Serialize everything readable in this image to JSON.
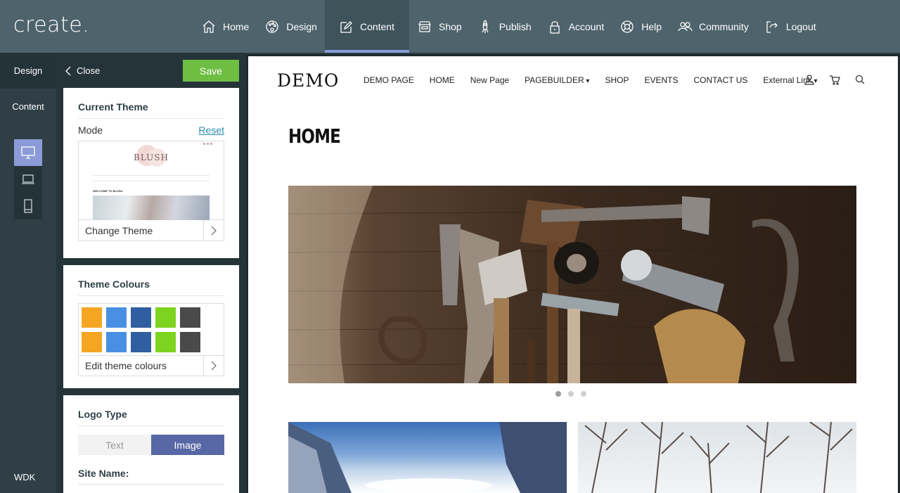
{
  "app": {
    "logo": "create.",
    "nav": [
      {
        "label": "Home",
        "icon": "home-icon"
      },
      {
        "label": "Design",
        "icon": "palette-icon"
      },
      {
        "label": "Content",
        "icon": "edit-icon",
        "active": true
      },
      {
        "label": "Shop",
        "icon": "shop-icon"
      },
      {
        "label": "Publish",
        "icon": "rocket-icon"
      },
      {
        "label": "Account",
        "icon": "lock-icon"
      },
      {
        "label": "Help",
        "icon": "lifebuoy-icon"
      },
      {
        "label": "Community",
        "icon": "community-icon"
      },
      {
        "label": "Logout",
        "icon": "logout-icon"
      }
    ]
  },
  "rail": {
    "design": "Design",
    "content": "Content",
    "wdk": "WDK",
    "devices": [
      "desktop-icon",
      "laptop-icon",
      "mobile-icon"
    ]
  },
  "panel": {
    "close": "Close",
    "save": "Save",
    "current_theme": {
      "title": "Current Theme",
      "mode": "Mode",
      "reset": "Reset",
      "theme_preview_name": "BLUSH",
      "theme_preview_welcome": "WELCOME TO BLUSH",
      "change_theme": "Change Theme"
    },
    "theme_colours": {
      "title": "Theme Colours",
      "swatches": [
        "#f4a623",
        "#4a90e2",
        "#2f5fa0",
        "#7ed321",
        "#4a4a4a",
        "#f4a623",
        "#4a90e2",
        "#2f5fa0",
        "#7ed321",
        "#4a4a4a"
      ],
      "edit": "Edit theme colours"
    },
    "logo_type": {
      "title": "Logo Type",
      "text_option": "Text",
      "image_option": "Image",
      "selected": "Image",
      "site_name": "Site Name:"
    }
  },
  "preview": {
    "site_logo": "DEMO",
    "nav": [
      "DEMO PAGE",
      "HOME",
      "New Page",
      "PAGEBUILDER",
      "SHOP",
      "EVENTS",
      "CONTACT US",
      "External Link"
    ],
    "icons": [
      "user-icon",
      "cart-icon",
      "search-icon"
    ],
    "page_title": "HOME",
    "slider": {
      "total": 3,
      "active": 1
    }
  },
  "colors": {
    "topbar": "#4e636b",
    "accent": "#8a9bd8",
    "save": "#6fbe44",
    "toggle_on": "#5868a6",
    "link": "#2a8fb0"
  }
}
